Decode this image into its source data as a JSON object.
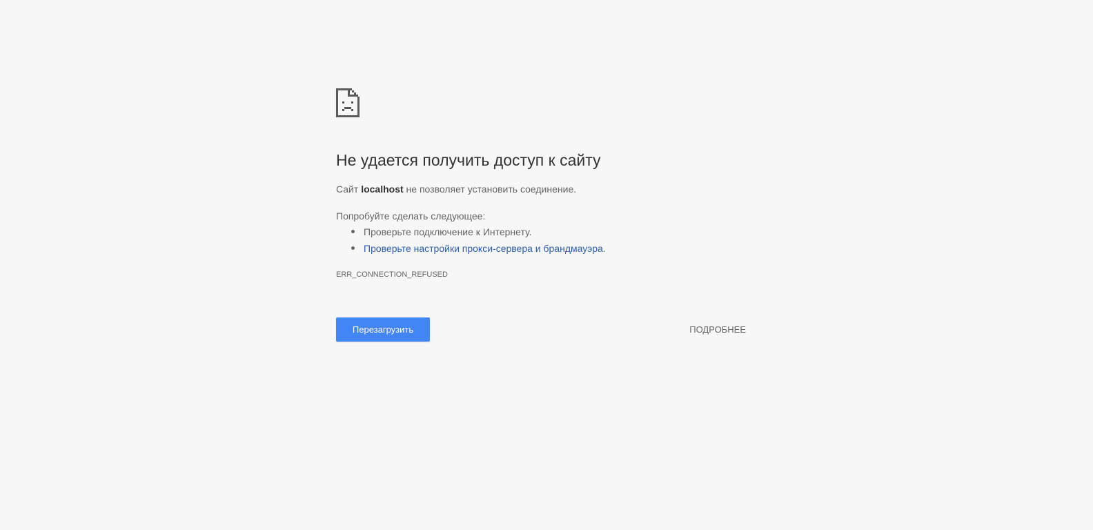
{
  "colors": {
    "background": "#f7f7f7",
    "primary_button": "#4285f4",
    "link": "#2a5db0",
    "title_text": "#333333",
    "body_text": "#646464"
  },
  "icon": "sad-page-icon",
  "error": {
    "title": "Не удается получить доступ к сайту",
    "summary_prefix": "Сайт ",
    "host": "localhost",
    "summary_suffix": " не позволяет установить соединение.",
    "suggestions_heading": "Попробуйте сделать следующее:",
    "suggestions": [
      {
        "text": "Проверьте подключение к Интернету.",
        "is_link": false
      },
      {
        "text": "Проверьте настройки прокси-сервера и брандмауэра",
        "is_link": true,
        "trailing": "."
      }
    ],
    "code": "ERR_CONNECTION_REFUSED"
  },
  "buttons": {
    "reload_label": "Перезагрузить",
    "details_label": "ПОДРОБНЕЕ"
  }
}
